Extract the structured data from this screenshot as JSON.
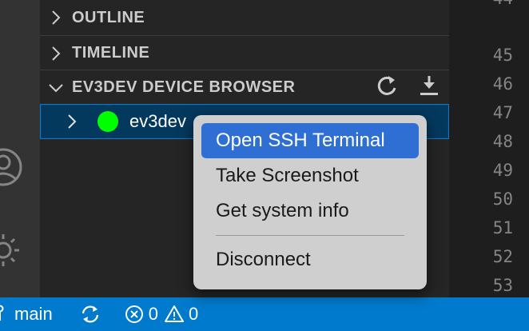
{
  "sidebar": {
    "sections": [
      {
        "label": "OUTLINE",
        "expanded": false
      },
      {
        "label": "TIMELINE",
        "expanded": false
      },
      {
        "label": "EV3DEV DEVICE BROWSER",
        "expanded": true
      }
    ],
    "device_browser": {
      "actions": [
        {
          "icon": "refresh-icon"
        },
        {
          "icon": "download-icon"
        }
      ],
      "device": {
        "name": "ev3dev",
        "status_color": "#00ff00",
        "expanded": false
      }
    }
  },
  "activity_bar": {
    "icons": [
      "account-icon",
      "settings-gear-icon"
    ]
  },
  "editor": {
    "line_numbers": [
      "44",
      "45",
      "46",
      "47",
      "48",
      "49",
      "50",
      "51",
      "52",
      "53"
    ]
  },
  "context_menu": {
    "items": [
      {
        "label": "Open SSH Terminal",
        "selected": true
      },
      {
        "label": "Take Screenshot",
        "selected": false
      },
      {
        "label": "Get system info",
        "selected": false
      },
      {
        "label": "Disconnect",
        "selected": false
      }
    ]
  },
  "status_bar": {
    "branch": "main",
    "errors": "0",
    "warnings": "0"
  },
  "colors": {
    "accent": "#007acc",
    "menu_selected": "#2f6fd3",
    "device_online": "#00ff00"
  }
}
